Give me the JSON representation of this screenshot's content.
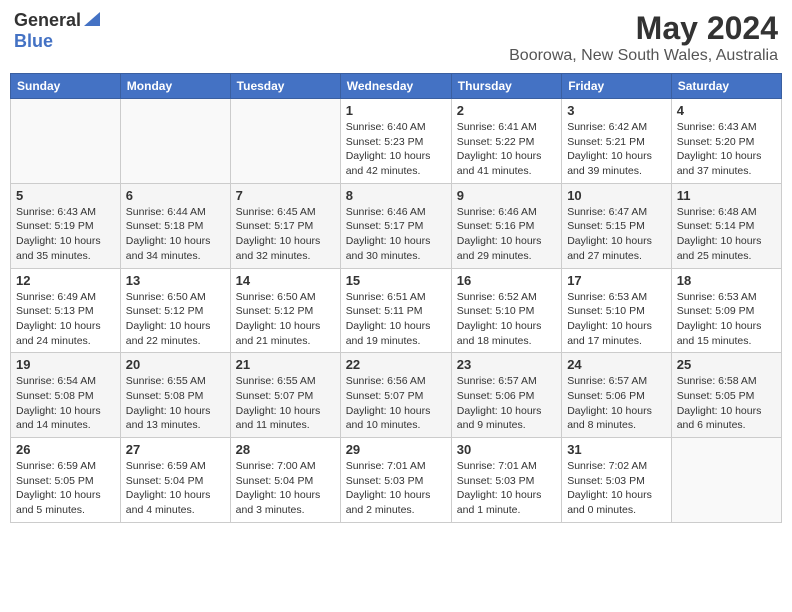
{
  "logo": {
    "general": "General",
    "blue": "Blue"
  },
  "title": "May 2024",
  "location": "Boorowa, New South Wales, Australia",
  "days_of_week": [
    "Sunday",
    "Monday",
    "Tuesday",
    "Wednesday",
    "Thursday",
    "Friday",
    "Saturday"
  ],
  "weeks": [
    [
      {
        "day": "",
        "info": ""
      },
      {
        "day": "",
        "info": ""
      },
      {
        "day": "",
        "info": ""
      },
      {
        "day": "1",
        "info": "Sunrise: 6:40 AM\nSunset: 5:23 PM\nDaylight: 10 hours and 42 minutes."
      },
      {
        "day": "2",
        "info": "Sunrise: 6:41 AM\nSunset: 5:22 PM\nDaylight: 10 hours and 41 minutes."
      },
      {
        "day": "3",
        "info": "Sunrise: 6:42 AM\nSunset: 5:21 PM\nDaylight: 10 hours and 39 minutes."
      },
      {
        "day": "4",
        "info": "Sunrise: 6:43 AM\nSunset: 5:20 PM\nDaylight: 10 hours and 37 minutes."
      }
    ],
    [
      {
        "day": "5",
        "info": "Sunrise: 6:43 AM\nSunset: 5:19 PM\nDaylight: 10 hours and 35 minutes."
      },
      {
        "day": "6",
        "info": "Sunrise: 6:44 AM\nSunset: 5:18 PM\nDaylight: 10 hours and 34 minutes."
      },
      {
        "day": "7",
        "info": "Sunrise: 6:45 AM\nSunset: 5:17 PM\nDaylight: 10 hours and 32 minutes."
      },
      {
        "day": "8",
        "info": "Sunrise: 6:46 AM\nSunset: 5:17 PM\nDaylight: 10 hours and 30 minutes."
      },
      {
        "day": "9",
        "info": "Sunrise: 6:46 AM\nSunset: 5:16 PM\nDaylight: 10 hours and 29 minutes."
      },
      {
        "day": "10",
        "info": "Sunrise: 6:47 AM\nSunset: 5:15 PM\nDaylight: 10 hours and 27 minutes."
      },
      {
        "day": "11",
        "info": "Sunrise: 6:48 AM\nSunset: 5:14 PM\nDaylight: 10 hours and 25 minutes."
      }
    ],
    [
      {
        "day": "12",
        "info": "Sunrise: 6:49 AM\nSunset: 5:13 PM\nDaylight: 10 hours and 24 minutes."
      },
      {
        "day": "13",
        "info": "Sunrise: 6:50 AM\nSunset: 5:12 PM\nDaylight: 10 hours and 22 minutes."
      },
      {
        "day": "14",
        "info": "Sunrise: 6:50 AM\nSunset: 5:12 PM\nDaylight: 10 hours and 21 minutes."
      },
      {
        "day": "15",
        "info": "Sunrise: 6:51 AM\nSunset: 5:11 PM\nDaylight: 10 hours and 19 minutes."
      },
      {
        "day": "16",
        "info": "Sunrise: 6:52 AM\nSunset: 5:10 PM\nDaylight: 10 hours and 18 minutes."
      },
      {
        "day": "17",
        "info": "Sunrise: 6:53 AM\nSunset: 5:10 PM\nDaylight: 10 hours and 17 minutes."
      },
      {
        "day": "18",
        "info": "Sunrise: 6:53 AM\nSunset: 5:09 PM\nDaylight: 10 hours and 15 minutes."
      }
    ],
    [
      {
        "day": "19",
        "info": "Sunrise: 6:54 AM\nSunset: 5:08 PM\nDaylight: 10 hours and 14 minutes."
      },
      {
        "day": "20",
        "info": "Sunrise: 6:55 AM\nSunset: 5:08 PM\nDaylight: 10 hours and 13 minutes."
      },
      {
        "day": "21",
        "info": "Sunrise: 6:55 AM\nSunset: 5:07 PM\nDaylight: 10 hours and 11 minutes."
      },
      {
        "day": "22",
        "info": "Sunrise: 6:56 AM\nSunset: 5:07 PM\nDaylight: 10 hours and 10 minutes."
      },
      {
        "day": "23",
        "info": "Sunrise: 6:57 AM\nSunset: 5:06 PM\nDaylight: 10 hours and 9 minutes."
      },
      {
        "day": "24",
        "info": "Sunrise: 6:57 AM\nSunset: 5:06 PM\nDaylight: 10 hours and 8 minutes."
      },
      {
        "day": "25",
        "info": "Sunrise: 6:58 AM\nSunset: 5:05 PM\nDaylight: 10 hours and 6 minutes."
      }
    ],
    [
      {
        "day": "26",
        "info": "Sunrise: 6:59 AM\nSunset: 5:05 PM\nDaylight: 10 hours and 5 minutes."
      },
      {
        "day": "27",
        "info": "Sunrise: 6:59 AM\nSunset: 5:04 PM\nDaylight: 10 hours and 4 minutes."
      },
      {
        "day": "28",
        "info": "Sunrise: 7:00 AM\nSunset: 5:04 PM\nDaylight: 10 hours and 3 minutes."
      },
      {
        "day": "29",
        "info": "Sunrise: 7:01 AM\nSunset: 5:03 PM\nDaylight: 10 hours and 2 minutes."
      },
      {
        "day": "30",
        "info": "Sunrise: 7:01 AM\nSunset: 5:03 PM\nDaylight: 10 hours and 1 minute."
      },
      {
        "day": "31",
        "info": "Sunrise: 7:02 AM\nSunset: 5:03 PM\nDaylight: 10 hours and 0 minutes."
      },
      {
        "day": "",
        "info": ""
      }
    ]
  ]
}
